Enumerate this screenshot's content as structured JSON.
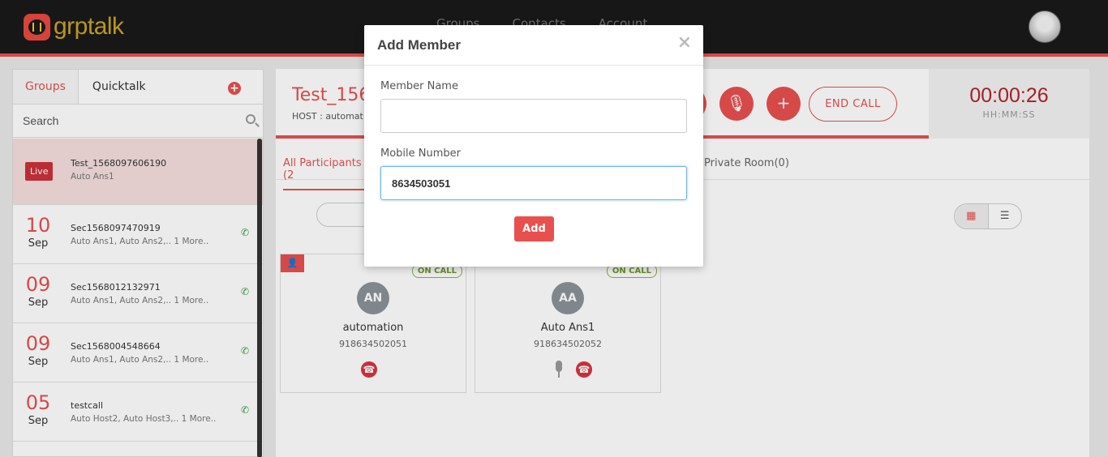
{
  "brand": {
    "name": "grptalk"
  },
  "nav": [
    "Groups",
    "Contacts",
    "Account"
  ],
  "sidebar": {
    "tabs": [
      "Groups",
      "Quicktalk"
    ],
    "search_placeholder": "Search",
    "calls": [
      {
        "badge": "Live",
        "name": "Test_1568097606190",
        "members": "Auto Ans1"
      },
      {
        "day": "10",
        "month": "Sep",
        "name": "Sec1568097470919",
        "members": "Auto Ans1, Auto Ans2,.. 1 More.."
      },
      {
        "day": "09",
        "month": "Sep",
        "name": "Sec1568012132971",
        "members": "Auto Ans1, Auto Ans2,.. 1 More.."
      },
      {
        "day": "09",
        "month": "Sep",
        "name": "Sec1568004548664",
        "members": "Auto Ans1, Auto Ans2,.. 1 More.."
      },
      {
        "day": "05",
        "month": "Sep",
        "name": "testcall",
        "members": "Auto Host2, Auto Host3,.. 1 More.."
      }
    ]
  },
  "call": {
    "title": "Test_156",
    "host": "HOST : automat",
    "end_call_label": "END CALL",
    "timer": "00:00:26",
    "timer_label": "HH:MM:SS",
    "tabs": {
      "all": "All Participants (2",
      "private": "Private Room(0)"
    }
  },
  "participants": [
    {
      "initials": "AN",
      "name": "automation",
      "number": "918634502051",
      "status": "ON CALL"
    },
    {
      "initials": "AA",
      "name": "Auto Ans1",
      "number": "918634502052",
      "status": "ON CALL"
    }
  ],
  "modal": {
    "title": "Add Member",
    "close": "×",
    "member_name_label": "Member Name",
    "member_name_value": "",
    "mobile_label": "Mobile Number",
    "mobile_value": "8634503051",
    "add_label": "Add"
  },
  "colors": {
    "accent": "#e8504f",
    "header": "#1a1a1a",
    "brand": "#c9a326"
  }
}
